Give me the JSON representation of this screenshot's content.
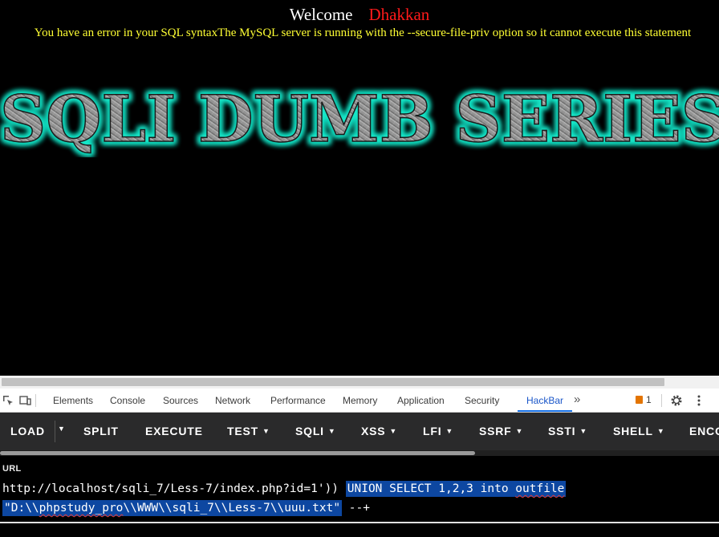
{
  "page": {
    "welcome_label": "Welcome",
    "welcome_user": "Dhakkan",
    "error_message": "You have an error in your SQL syntaxThe MySQL server is running with the --secure-file-priv option so it cannot execute this statement",
    "banner_text": "SQLI DUMB SERIES"
  },
  "devtools": {
    "tabs": [
      {
        "label": "Elements"
      },
      {
        "label": "Console"
      },
      {
        "label": "Sources"
      },
      {
        "label": "Network"
      },
      {
        "label": "Performance"
      },
      {
        "label": "Memory"
      },
      {
        "label": "Application"
      },
      {
        "label": "Security"
      },
      {
        "label": "HackBar"
      }
    ],
    "active_tab": "HackBar",
    "more_tabs_label": "»",
    "issues_count": "1",
    "settings_icon": "gear-icon",
    "menu_icon": "kebab-menu-icon"
  },
  "hackbar": {
    "buttons": [
      {
        "label": "LOAD"
      },
      {
        "label": "SPLIT"
      },
      {
        "label": "EXECUTE"
      },
      {
        "label": "TEST"
      },
      {
        "label": "SQLI"
      },
      {
        "label": "XSS"
      },
      {
        "label": "LFI"
      },
      {
        "label": "SSRF"
      },
      {
        "label": "SSTI"
      },
      {
        "label": "SHELL"
      },
      {
        "label": "ENCO"
      }
    ],
    "url_label": "URL",
    "url_line1_plain": "http://localhost/sqli_7/Less-7/index.php?id=1'))",
    "url_line1_sel_a": "UNION SELECT 1,2,3 into ",
    "url_line1_sel_b": "outfile",
    "url_line2_sel_a": "\"D:\\\\",
    "url_line2_sel_b": "phpstudy_pro",
    "url_line2_sel_c": "\\\\WWW\\\\sqli_7\\\\Less-7\\\\uuu.txt\"",
    "url_line2_plain": " --+"
  },
  "colors": {
    "welcome_user": "#ff1a1a",
    "error_text": "#ffff33",
    "selection": "#0d47a1",
    "hackbar_bg": "#2a2a2b",
    "active_tab": "#1a73e8"
  }
}
